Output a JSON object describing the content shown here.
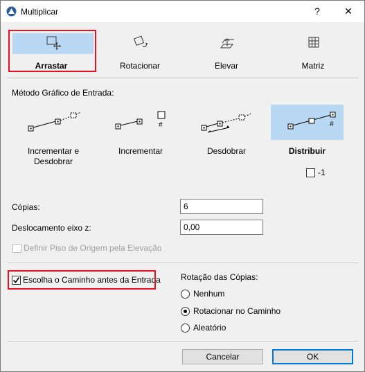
{
  "window": {
    "title": "Multiplicar",
    "help": "?",
    "close": "✕"
  },
  "modes": [
    {
      "label": "Arrastar",
      "icon": "drag-icon"
    },
    {
      "label": "Rotacionar",
      "icon": "rotate-icon"
    },
    {
      "label": "Elevar",
      "icon": "elevate-icon"
    },
    {
      "label": "Matriz",
      "icon": "matrix-icon"
    }
  ],
  "input_method": {
    "heading": "Método Gráfico de Entrada:",
    "options": [
      {
        "label": "Incrementar e Desdobrar"
      },
      {
        "label": "Incrementar"
      },
      {
        "label": "Desdobrar"
      },
      {
        "label": "Distribuir",
        "selected": true
      }
    ],
    "distribute_minus_one": "-1"
  },
  "fields": {
    "copies_label": "Cópias:",
    "copies_value": "6",
    "z_offset_label": "Deslocamento eixo z:",
    "z_offset_value": "0,00"
  },
  "floor_option": {
    "label": "Definir Piso de Origem pela Elevação",
    "disabled": true
  },
  "path_option": {
    "label": "Escolha o Caminho antes da Entrada",
    "checked": true
  },
  "rotation": {
    "heading": "Rotação das Cópias:",
    "options": [
      "Nenhum",
      "Rotacionar no Caminho",
      "Aleatório"
    ],
    "selected": 1
  },
  "buttons": {
    "cancel": "Cancelar",
    "ok": "OK"
  }
}
